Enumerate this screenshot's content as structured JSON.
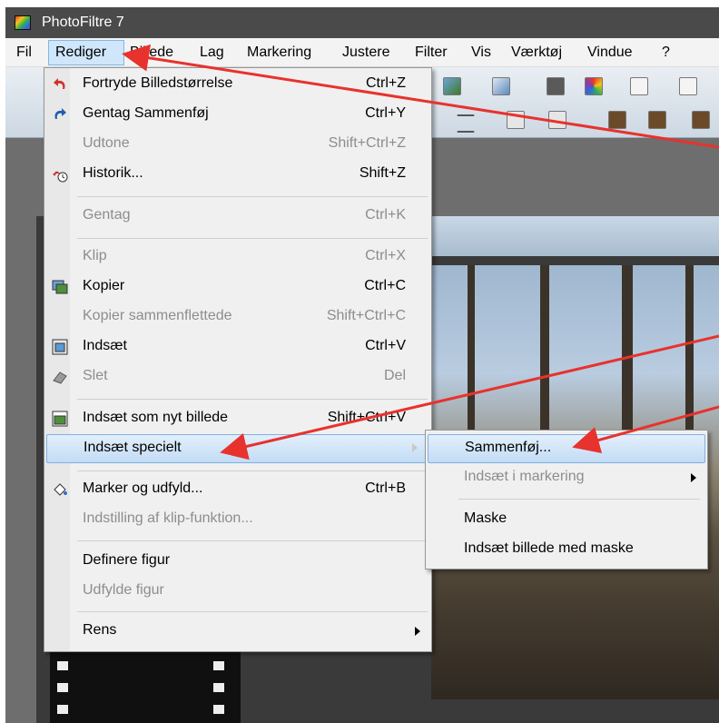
{
  "window": {
    "title": "PhotoFiltre 7"
  },
  "menubar": {
    "items": [
      "Fil",
      "Rediger",
      "Billede",
      "Lag",
      "Markering",
      "Justere",
      "Filter",
      "Vis",
      "Værktøj",
      "Vindue",
      "?"
    ],
    "active_index": 1
  },
  "edit_menu": {
    "items": [
      {
        "label": "Fortryde Billedstørrelse",
        "shortcut": "Ctrl+Z",
        "enabled": true,
        "icon": "undo-icon"
      },
      {
        "label": "Gentag Sammenføj",
        "shortcut": "Ctrl+Y",
        "enabled": true,
        "icon": "redo-icon"
      },
      {
        "label": "Udtone",
        "shortcut": "Shift+Ctrl+Z",
        "enabled": false
      },
      {
        "label": "Historik...",
        "shortcut": "Shift+Z",
        "enabled": true,
        "icon": "history-icon"
      },
      {
        "label": "Gentag",
        "shortcut": "Ctrl+K",
        "enabled": false
      },
      {
        "label": "Klip",
        "shortcut": "Ctrl+X",
        "enabled": false
      },
      {
        "label": "Kopier",
        "shortcut": "Ctrl+C",
        "enabled": true,
        "icon": "copy-icon"
      },
      {
        "label": "Kopier sammenflettede",
        "shortcut": "Shift+Ctrl+C",
        "enabled": false
      },
      {
        "label": "Indsæt",
        "shortcut": "Ctrl+V",
        "enabled": true,
        "icon": "paste-icon"
      },
      {
        "label": "Slet",
        "shortcut": "Del",
        "enabled": false,
        "icon": "eraser-icon"
      },
      {
        "label": "Indsæt som nyt billede",
        "shortcut": "Shift+Ctrl+V",
        "enabled": true,
        "icon": "paste-new-image-icon"
      },
      {
        "label": "Indsæt specielt",
        "shortcut": "",
        "enabled": true,
        "submenu": true,
        "highlighted": true
      },
      {
        "label": "Marker og udfyld...",
        "shortcut": "Ctrl+B",
        "enabled": true,
        "icon": "fill-bucket-icon"
      },
      {
        "label": "Indstilling af klip-funktion...",
        "shortcut": "",
        "enabled": false
      },
      {
        "label": "Definere figur",
        "shortcut": "",
        "enabled": true
      },
      {
        "label": "Udfylde figur",
        "shortcut": "",
        "enabled": false
      },
      {
        "label": "Rens",
        "shortcut": "",
        "enabled": true,
        "submenu": true
      }
    ]
  },
  "paste_special_submenu": {
    "items": [
      {
        "label": "Sammenføj...",
        "enabled": true,
        "highlighted": true
      },
      {
        "label": "Indsæt i markering",
        "enabled": false,
        "submenu": true
      },
      {
        "label": "Maske",
        "enabled": true
      },
      {
        "label": "Indsæt billede med maske",
        "enabled": true
      }
    ]
  },
  "annotation": {
    "arrow_color": "#e8322d"
  }
}
